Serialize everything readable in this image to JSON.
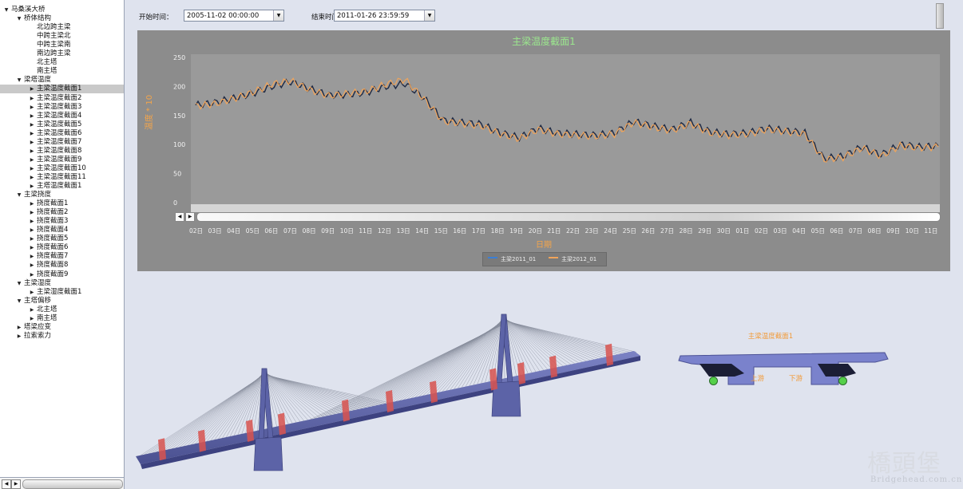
{
  "tree": {
    "items": [
      {
        "label": "马桑溪大桥",
        "level": 0,
        "toggle": "▼"
      },
      {
        "label": "桥体结构",
        "level": 1,
        "toggle": "▼"
      },
      {
        "label": "北边跨主梁",
        "level": 2,
        "toggle": ""
      },
      {
        "label": "中跨主梁北",
        "level": 2,
        "toggle": ""
      },
      {
        "label": "中跨主梁南",
        "level": 2,
        "toggle": ""
      },
      {
        "label": "南边跨主梁",
        "level": 2,
        "toggle": ""
      },
      {
        "label": "北主塔",
        "level": 2,
        "toggle": ""
      },
      {
        "label": "南主塔",
        "level": 2,
        "toggle": ""
      },
      {
        "label": "梁塔温度",
        "level": 1,
        "toggle": "▼"
      },
      {
        "label": "主梁温度截面1",
        "level": 2,
        "toggle": "▶",
        "selected": true
      },
      {
        "label": "主梁温度截面2",
        "level": 2,
        "toggle": "▶"
      },
      {
        "label": "主梁温度截面3",
        "level": 2,
        "toggle": "▶"
      },
      {
        "label": "主梁温度截面4",
        "level": 2,
        "toggle": "▶"
      },
      {
        "label": "主梁温度截面5",
        "level": 2,
        "toggle": "▶"
      },
      {
        "label": "主梁温度截面6",
        "level": 2,
        "toggle": "▶"
      },
      {
        "label": "主梁温度截面7",
        "level": 2,
        "toggle": "▶"
      },
      {
        "label": "主梁温度截面8",
        "level": 2,
        "toggle": "▶"
      },
      {
        "label": "主梁温度截面9",
        "level": 2,
        "toggle": "▶"
      },
      {
        "label": "主梁温度截面10",
        "level": 2,
        "toggle": "▶"
      },
      {
        "label": "主梁温度截面11",
        "level": 2,
        "toggle": "▶"
      },
      {
        "label": "主塔温度截面1",
        "level": 2,
        "toggle": "▶"
      },
      {
        "label": "主梁挠度",
        "level": 1,
        "toggle": "▼"
      },
      {
        "label": "挠度截面1",
        "level": 2,
        "toggle": "▶"
      },
      {
        "label": "挠度截面2",
        "level": 2,
        "toggle": "▶"
      },
      {
        "label": "挠度截面3",
        "level": 2,
        "toggle": "▶"
      },
      {
        "label": "挠度截面4",
        "level": 2,
        "toggle": "▶"
      },
      {
        "label": "挠度截面5",
        "level": 2,
        "toggle": "▶"
      },
      {
        "label": "挠度截面6",
        "level": 2,
        "toggle": "▶"
      },
      {
        "label": "挠度截面7",
        "level": 2,
        "toggle": "▶"
      },
      {
        "label": "挠度截面8",
        "level": 2,
        "toggle": "▶"
      },
      {
        "label": "挠度截面9",
        "level": 2,
        "toggle": "▶"
      },
      {
        "label": "主梁湿度",
        "level": 1,
        "toggle": "▼"
      },
      {
        "label": "主梁湿度截面1",
        "level": 2,
        "toggle": "▶"
      },
      {
        "label": "主塔偏移",
        "level": 1,
        "toggle": "▼"
      },
      {
        "label": "北主塔",
        "level": 2,
        "toggle": "▶"
      },
      {
        "label": "南主塔",
        "level": 2,
        "toggle": "▶"
      },
      {
        "label": "塔梁应变",
        "level": 1,
        "toggle": "▶"
      },
      {
        "label": "拉索索力",
        "level": 1,
        "toggle": "▶"
      }
    ]
  },
  "toolbar": {
    "start_label": "开始时间：",
    "start_value": "2005-11-02 00:00:00",
    "end_label": "结束时间：",
    "end_value": "2011-01-26 23:59:59"
  },
  "chart_data": {
    "type": "line",
    "title": "主梁温度截面1",
    "ylabel": "温度 * 10",
    "xlabel": "日期",
    "ylim": [
      0,
      250
    ],
    "yticks": [
      0,
      50,
      100,
      150,
      200,
      250
    ],
    "grid": false,
    "legend": "bottom",
    "categories": [
      "02日",
      "03日",
      "04日",
      "05日",
      "06日",
      "07日",
      "08日",
      "09日",
      "10日",
      "11日",
      "12日",
      "13日",
      "14日",
      "15日",
      "16日",
      "17日",
      "18日",
      "19日",
      "20日",
      "21日",
      "22日",
      "23日",
      "24日",
      "25日",
      "26日",
      "27日",
      "28日",
      "29日",
      "30日",
      "01日",
      "02日",
      "03日",
      "04日",
      "05日",
      "06日",
      "07日",
      "08日",
      "09日",
      "10日",
      "11日"
    ],
    "tick_labels": [
      "02日",
      "03日",
      "04日",
      "05日",
      "06日",
      "07日",
      "08日",
      "09日",
      "10日",
      "11日",
      "12日",
      "13日",
      "14日",
      "15日",
      "16日",
      "17日",
      "18日",
      "19日",
      "20日",
      "21日",
      "22日",
      "23日",
      "24日",
      "25日",
      "26日",
      "27日",
      "28日",
      "29日",
      "30日",
      "01日",
      "02日",
      "03日",
      "04日",
      "05日",
      "06日",
      "07日",
      "08日",
      "09日",
      "10日",
      "11日"
    ],
    "series": [
      {
        "name": "主梁2011_01",
        "color": "#1f2a44",
        "values": [
          168,
          172,
          180,
          188,
          200,
          208,
          196,
          185,
          186,
          190,
          200,
          205,
          180,
          142,
          138,
          135,
          120,
          112,
          128,
          120,
          118,
          116,
          120,
          140,
          132,
          126,
          138,
          122,
          118,
          120,
          128,
          124,
          120,
          76,
          80,
          96,
          82,
          100,
          96,
          98
        ]
      },
      {
        "name": "主梁2012_01",
        "color": "#f0a45a",
        "values": [
          166,
          170,
          179,
          190,
          204,
          210,
          194,
          184,
          188,
          192,
          204,
          212,
          178,
          140,
          136,
          132,
          118,
          110,
          126,
          118,
          116,
          114,
          118,
          138,
          130,
          124,
          136,
          120,
          116,
          118,
          126,
          122,
          118,
          74,
          78,
          94,
          80,
          98,
          94,
          96
        ]
      }
    ]
  },
  "section_view": {
    "title": "主梁温度截面1",
    "label_up": "上游",
    "label_down": "下游"
  },
  "watermark": {
    "cn": "橋頭堡",
    "en": "Bridgehead.com.cn"
  }
}
